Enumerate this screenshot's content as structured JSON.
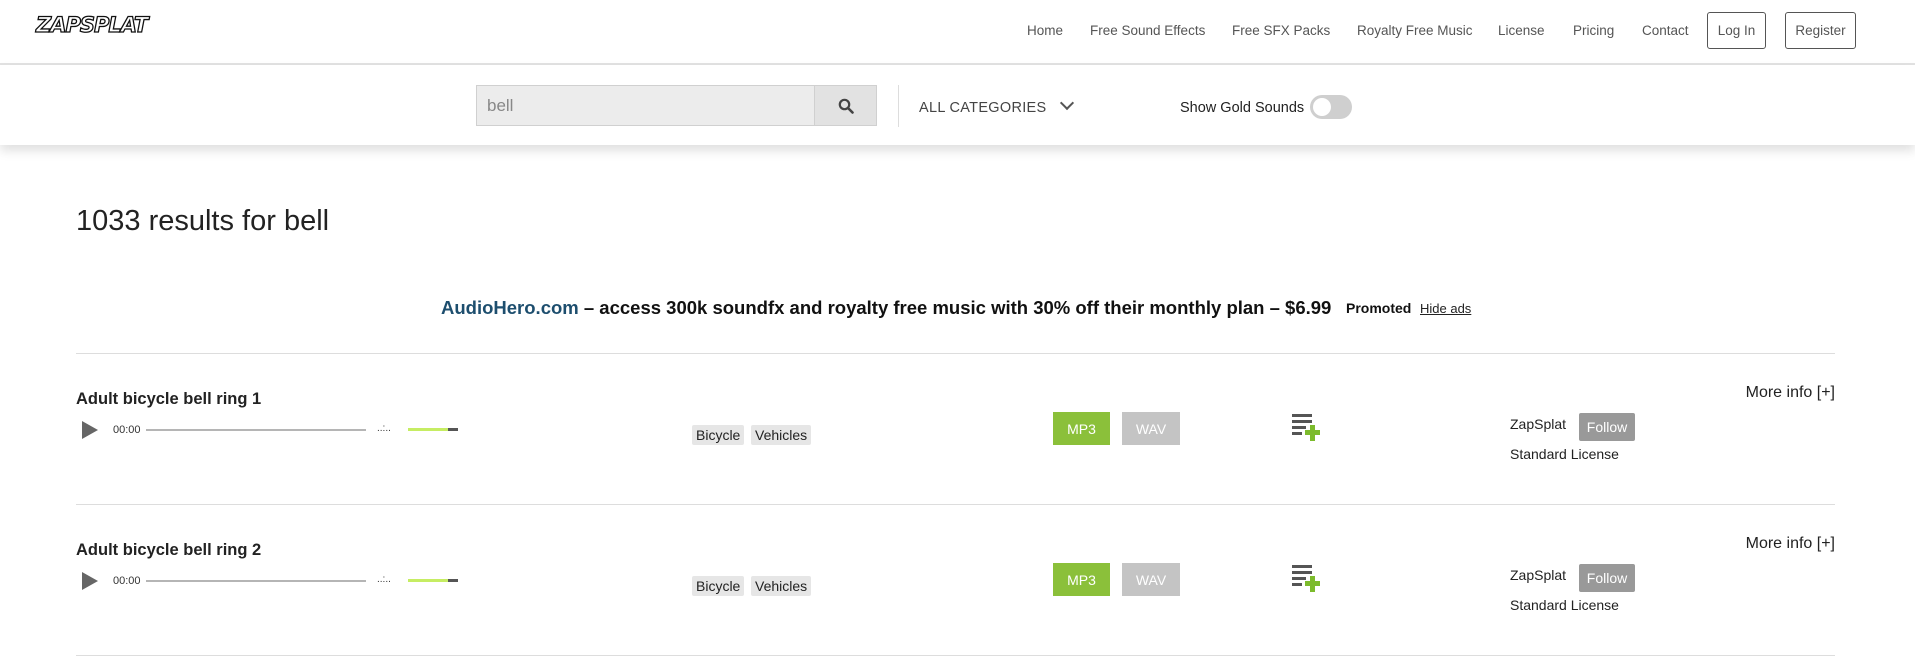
{
  "header": {
    "logo_text": "ZAPSPLAT",
    "nav": [
      "Home",
      "Free Sound Effects",
      "Free SFX Packs",
      "Royalty Free Music",
      "License",
      "Pricing",
      "Contact"
    ],
    "login": "Log In",
    "register": "Register"
  },
  "search": {
    "value": "bell",
    "category": "ALL CATEGORIES",
    "gold_label": "Show Gold Sounds",
    "gold_on": false
  },
  "results_title": "1033 results for bell",
  "ad": {
    "brand": "AudioHero.com",
    "text": " – access 300k soundfx and royalty free music with 30% off their monthly plan – $6.99",
    "promoted": "Promoted",
    "hide": "Hide ads"
  },
  "colors": {
    "accent_green": "#8bc03a",
    "link_blue": "#1d4e6e"
  },
  "results": [
    {
      "title": "Adult bicycle bell ring 1",
      "time": "00:00",
      "duration": "..:..",
      "tags": [
        "Bicycle",
        "Vehicles"
      ],
      "mp3": "MP3",
      "wav": "WAV",
      "author": "ZapSplat",
      "follow": "Follow",
      "license": "Standard License",
      "more": "More info [+]"
    },
    {
      "title": "Adult bicycle bell ring 2",
      "time": "00:00",
      "duration": "..:..",
      "tags": [
        "Bicycle",
        "Vehicles"
      ],
      "mp3": "MP3",
      "wav": "WAV",
      "author": "ZapSplat",
      "follow": "Follow",
      "license": "Standard License",
      "more": "More info [+]"
    }
  ]
}
